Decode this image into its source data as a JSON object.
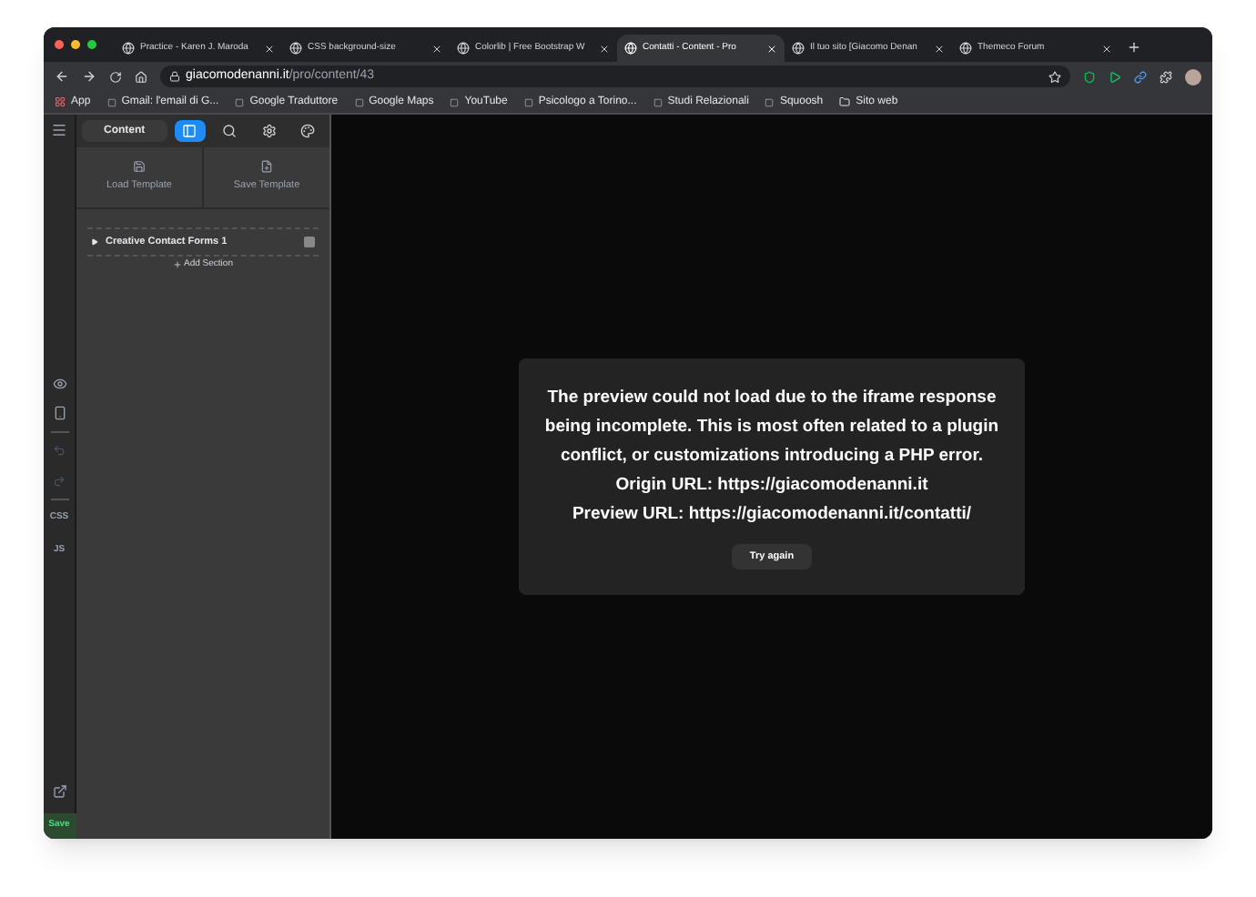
{
  "tabs": [
    {
      "title": "Practice - Karen J. Maroda",
      "selected": false
    },
    {
      "title": "CSS background-size",
      "selected": false
    },
    {
      "title": "Colorlib | Free Bootstrap W",
      "selected": false
    },
    {
      "title": "Contatti - Content - Pro",
      "selected": true
    },
    {
      "title": "Il tuo sito [Giacomo Denan",
      "selected": false
    },
    {
      "title": "Themeco Forum",
      "selected": false
    }
  ],
  "address": {
    "host": "giacomodenanni.it",
    "path": "/pro/content/43"
  },
  "bookmarks": [
    "App",
    "Gmail: l'email di G...",
    "Google Traduttore",
    "Google Maps",
    "YouTube",
    "Psicologo a Torino...",
    "Studi Relazionali",
    "Squoosh",
    "Sito web"
  ],
  "rail": {
    "css": "CSS",
    "js": "JS",
    "save": "Save"
  },
  "panel": {
    "tabs": [
      {
        "kind": "text",
        "label": "Content",
        "selected": false
      },
      {
        "kind": "layout",
        "selected": true
      },
      {
        "kind": "search",
        "selected": false
      },
      {
        "kind": "gear",
        "selected": false
      },
      {
        "kind": "palette",
        "selected": false
      }
    ],
    "templates": [
      "Load Template",
      "Save Template"
    ],
    "tree": [
      {
        "label": "Creative Contact Forms 1",
        "expanded": false
      }
    ],
    "add_section": "Add Section"
  },
  "preview": {
    "message": "The preview could not load due to the iframe response being incomplete. This is most often related to a plugin conflict, or customizations introducing a PHP error.",
    "origin": "Origin URL: https://giacomodenanni.it",
    "preview_url": "Preview URL: https://giacomodenanni.it/contatti/",
    "button": "Try again"
  }
}
